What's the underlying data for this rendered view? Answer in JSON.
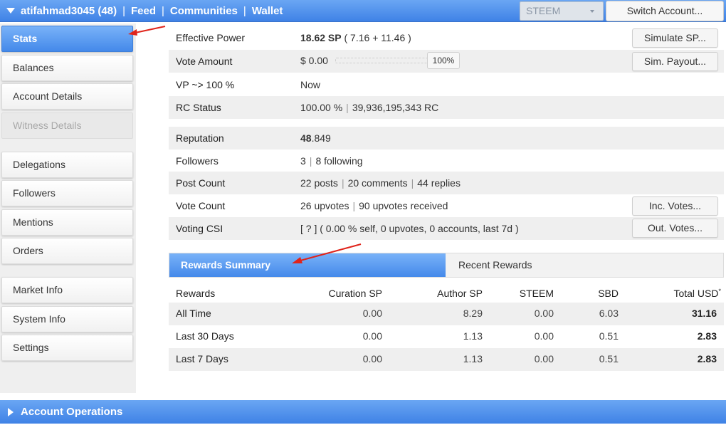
{
  "header": {
    "account": "atifahmad3045 (48)",
    "nav": [
      "Feed",
      "Communities",
      "Wallet"
    ],
    "sep": "|",
    "token_select": "STEEM",
    "switch_button": "Switch Account..."
  },
  "sidebar": {
    "items": [
      {
        "label": "Stats"
      },
      {
        "label": "Balances"
      },
      {
        "label": "Account Details"
      },
      {
        "label": "Witness Details"
      },
      {
        "label": "Delegations"
      },
      {
        "label": "Followers"
      },
      {
        "label": "Mentions"
      },
      {
        "label": "Orders"
      },
      {
        "label": "Market Info"
      },
      {
        "label": "System Info"
      },
      {
        "label": "Settings"
      }
    ]
  },
  "stats": {
    "effective_power": {
      "label": "Effective Power",
      "sp": "18.62 SP",
      "detail": "( 7.16 + 11.46 )",
      "button": "Simulate SP..."
    },
    "vote_amount": {
      "label": "Vote Amount",
      "value": "$ 0.00",
      "percent": "100%",
      "button": "Sim. Payout..."
    },
    "vp": {
      "label": "VP ~> 100 %",
      "value": "Now"
    },
    "rc_status": {
      "label": "RC Status",
      "percent": "100.00 %",
      "rc": "39,936,195,343 RC"
    },
    "reputation": {
      "label": "Reputation",
      "bold": "48",
      "rest": ".849"
    },
    "followers": {
      "label": "Followers",
      "count": "3",
      "following": "8 following"
    },
    "post_count": {
      "label": "Post Count",
      "posts": "22 posts",
      "comments": "20 comments",
      "replies": "44 replies"
    },
    "vote_count": {
      "label": "Vote Count",
      "upvotes": "26 upvotes",
      "received": "90 upvotes received",
      "button": "Inc. Votes..."
    },
    "voting_csi": {
      "label": "Voting CSI",
      "value": "[ ? ] ( 0.00 % self, 0 upvotes, 0 accounts, last 7d )",
      "button": "Out. Votes..."
    }
  },
  "rewards": {
    "tabs": {
      "active": "Rewards Summary",
      "inactive": "Recent Rewards"
    },
    "headers": [
      "Rewards",
      "Curation SP",
      "Author SP",
      "STEEM",
      "SBD",
      "Total USD"
    ],
    "header_mark": "*",
    "rows": [
      [
        "All Time",
        "0.00",
        "8.29",
        "0.00",
        "6.03",
        "31.16"
      ],
      [
        "Last 30 Days",
        "0.00",
        "1.13",
        "0.00",
        "0.51",
        "2.83"
      ],
      [
        "Last 7 Days",
        "0.00",
        "1.13",
        "0.00",
        "0.51",
        "2.83"
      ]
    ]
  },
  "footer": {
    "label": "Account Operations"
  },
  "colors": {
    "accent": "#4489ea",
    "arrow": "#e0241b"
  }
}
